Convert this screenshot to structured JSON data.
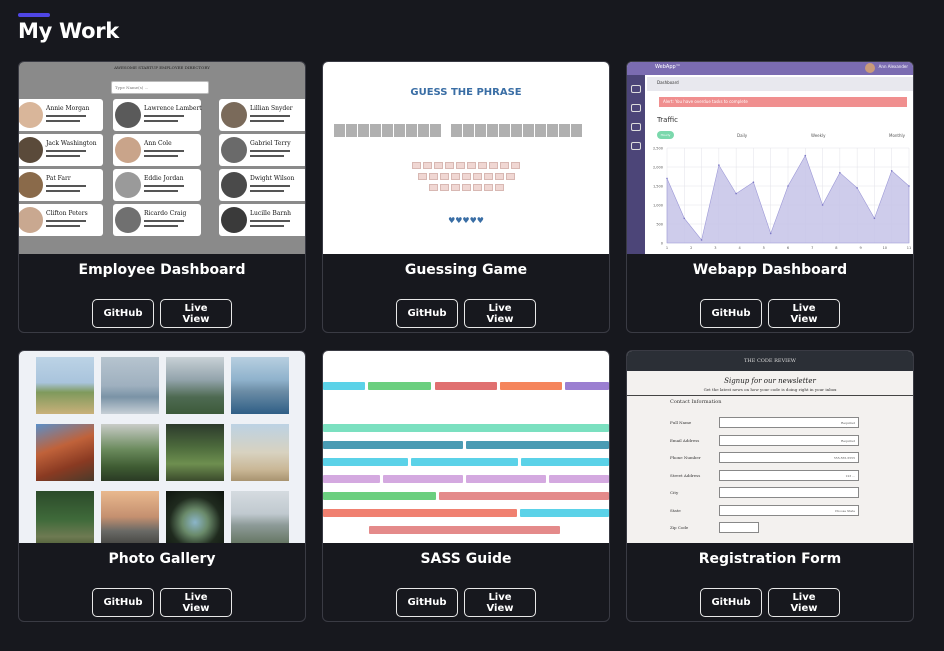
{
  "section": {
    "title": "My Work",
    "accent_color": "#4f46e5"
  },
  "projects": [
    {
      "title": "Employee Dashboard",
      "github_label": "GitHub",
      "live_label": "Live View"
    },
    {
      "title": "Guessing Game",
      "github_label": "GitHub",
      "live_label": "Live View"
    },
    {
      "title": "Webapp Dashboard",
      "github_label": "GitHub",
      "live_label": "Live View"
    },
    {
      "title": "Photo Gallery",
      "github_label": "GitHub",
      "live_label": "Live View"
    },
    {
      "title": "SASS Guide",
      "github_label": "GitHub",
      "live_label": "Live View"
    },
    {
      "title": "Registration Form",
      "github_label": "GitHub",
      "live_label": "Live View"
    }
  ],
  "thumbnails": {
    "employee": {
      "search_placeholder": "Type Name(s) ...",
      "names": [
        "Annie Morgan",
        "Lawrence Lambert",
        "Lillian Snyder",
        "Jack Washington",
        "Ann Cole",
        "Gabriel Terry",
        "Pat Farr",
        "Eddie Jordan",
        "Dwight Wilson",
        "Clifton Peters",
        "Ricardo Craig",
        "Lucille Barnh"
      ]
    },
    "guess": {
      "title": "GUESS THE PHRASE",
      "hearts": "♥♥♥♥♥"
    },
    "webapp": {
      "brand": "WebApp™",
      "tab": "Dashboard",
      "traffic": "Traffic",
      "periods": [
        "Hourly",
        "Daily",
        "Weekly",
        "Monthly"
      ],
      "y_ticks": [
        "2,500",
        "2,000",
        "1,500",
        "1,000",
        "500",
        "0"
      ],
      "x_ticks": [
        "1",
        "2",
        "3",
        "4",
        "5",
        "6",
        "7",
        "8",
        "9",
        "10",
        "11"
      ],
      "traffic_values": [
        1700,
        650,
        80,
        2050,
        1300,
        1600,
        250,
        1500,
        2300,
        1000,
        1850,
        1450,
        650,
        1900,
        1500
      ]
    },
    "registration": {
      "header": "THE CODE REVIEW",
      "title": "Signup for our newsletter",
      "subtitle": "Get the latest news on how your code is doing right in your inbox",
      "section": "Contact Information",
      "fields": [
        {
          "label": "Full Name",
          "placeholder": "Required"
        },
        {
          "label": "Email Address",
          "placeholder": "Required"
        },
        {
          "label": "Phone Number",
          "placeholder": "555-555-5555"
        },
        {
          "label": "Street Address",
          "placeholder": "123 ..."
        },
        {
          "label": "City",
          "placeholder": ""
        },
        {
          "label": "State",
          "placeholder": "Choose State"
        },
        {
          "label": "Zip Code",
          "placeholder": ""
        }
      ]
    }
  }
}
